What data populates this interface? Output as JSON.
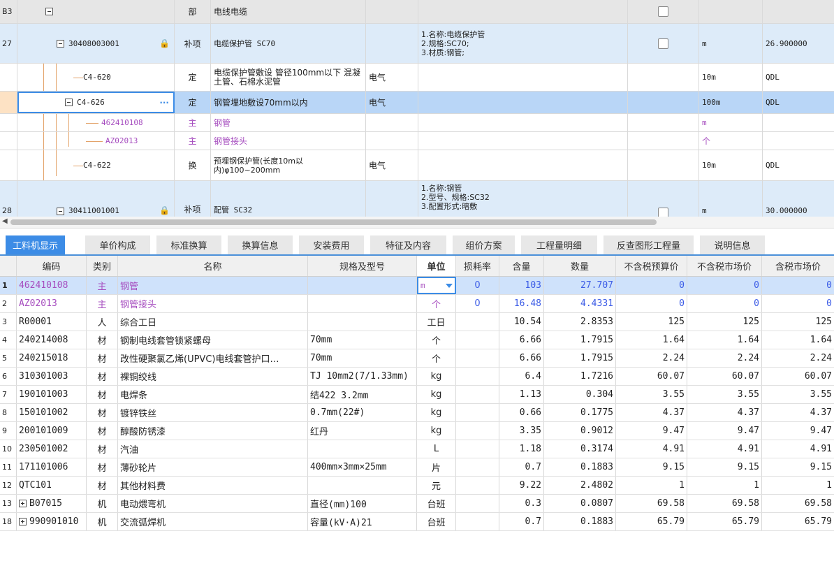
{
  "top_rows": [
    {
      "num": "B3",
      "code": "",
      "type": "部",
      "name": "电线电缆",
      "spec": "",
      "features": "",
      "unit": "",
      "qty": ""
    },
    {
      "num": "27",
      "code": "30408003001",
      "type": "补项",
      "name": "电缆保护管 SC70",
      "spec": "",
      "features": "1.名称:电缆保护管\n2.规格:SC70;\n3.材质:钢管;",
      "unit": "m",
      "qty": "26.900000"
    },
    {
      "num": "",
      "code": "C4-620",
      "type": "定",
      "name": "电缆保护管敷设 管径100mm以下 混凝土管、石棉水泥管",
      "spec": "电气",
      "features": "",
      "unit": "10m",
      "qty": "QDL"
    },
    {
      "num": "",
      "code": "C4-626",
      "type": "定",
      "name": "钢管埋地敷设70mm以内",
      "spec": "电气",
      "features": "",
      "unit": "100m",
      "qty": "QDL"
    },
    {
      "num": "",
      "code": "462410108",
      "type": "主",
      "name": "钢管",
      "spec": "",
      "features": "",
      "unit": "m",
      "qty": ""
    },
    {
      "num": "",
      "code": "AZ02013",
      "type": "主",
      "name": "钢管接头",
      "spec": "",
      "features": "",
      "unit": "个",
      "qty": ""
    },
    {
      "num": "",
      "code": "C4-622",
      "type": "换",
      "name": "预埋钢保护管(长度10m以内)φ100~200mm",
      "spec": "电气",
      "features": "",
      "unit": "10m",
      "qty": "QDL"
    },
    {
      "num": "28",
      "code": "30411001001",
      "type": "补项",
      "name": "配管 SC32",
      "spec": "",
      "features": "1.名称:钢管\n2.型号、规格:SC32\n3.配置形式:暗敷",
      "unit": "m",
      "qty": "30.000000"
    }
  ],
  "tabs": [
    "工料机显示",
    "单价构成",
    "标准换算",
    "换算信息",
    "安装费用",
    "特征及内容",
    "组价方案",
    "工程量明细",
    "反查图形工程量",
    "说明信息"
  ],
  "bottom_headers": [
    "",
    "编码",
    "类别",
    "名称",
    "规格及型号",
    "单位",
    "损耗率",
    "含量",
    "数量",
    "不含税预算价",
    "不含税市场价",
    "含税市场价"
  ],
  "bottom_rows": [
    {
      "n": "1",
      "code": "462410108",
      "cat": "主",
      "name": "钢管",
      "spec": "",
      "unit": "m",
      "loss": "0",
      "content": "103",
      "qty": "27.707",
      "p1": "0",
      "p2": "0",
      "p3": "0"
    },
    {
      "n": "2",
      "code": "AZ02013",
      "cat": "主",
      "name": "钢管接头",
      "spec": "",
      "unit": "个",
      "loss": "0",
      "content": "16.48",
      "qty": "4.4331",
      "p1": "0",
      "p2": "0",
      "p3": "0"
    },
    {
      "n": "3",
      "code": "R00001",
      "cat": "人",
      "name": "综合工日",
      "spec": "",
      "unit": "工日",
      "loss": "",
      "content": "10.54",
      "qty": "2.8353",
      "p1": "125",
      "p2": "125",
      "p3": "125"
    },
    {
      "n": "4",
      "code": "240214008",
      "cat": "材",
      "name": "钢制电线套管锁紧螺母",
      "spec": "70mm",
      "unit": "个",
      "loss": "",
      "content": "6.66",
      "qty": "1.7915",
      "p1": "1.64",
      "p2": "1.64",
      "p3": "1.64"
    },
    {
      "n": "5",
      "code": "240215018",
      "cat": "材",
      "name": "改性硬聚氯乙烯(UPVC)电线套管护口…",
      "spec": "70mm",
      "unit": "个",
      "loss": "",
      "content": "6.66",
      "qty": "1.7915",
      "p1": "2.24",
      "p2": "2.24",
      "p3": "2.24"
    },
    {
      "n": "6",
      "code": "310301003",
      "cat": "材",
      "name": "裸铜绞线",
      "spec": "TJ 10mm2(7/1.33mm)",
      "unit": "kg",
      "loss": "",
      "content": "6.4",
      "qty": "1.7216",
      "p1": "60.07",
      "p2": "60.07",
      "p3": "60.07"
    },
    {
      "n": "7",
      "code": "190101003",
      "cat": "材",
      "name": "电焊条",
      "spec": "结422 3.2mm",
      "unit": "kg",
      "loss": "",
      "content": "1.13",
      "qty": "0.304",
      "p1": "3.55",
      "p2": "3.55",
      "p3": "3.55"
    },
    {
      "n": "8",
      "code": "150101002",
      "cat": "材",
      "name": "镀锌铁丝",
      "spec": "0.7mm(22#)",
      "unit": "kg",
      "loss": "",
      "content": "0.66",
      "qty": "0.1775",
      "p1": "4.37",
      "p2": "4.37",
      "p3": "4.37"
    },
    {
      "n": "9",
      "code": "200101009",
      "cat": "材",
      "name": "醇酸防锈漆",
      "spec": "红丹",
      "unit": "kg",
      "loss": "",
      "content": "3.35",
      "qty": "0.9012",
      "p1": "9.47",
      "p2": "9.47",
      "p3": "9.47"
    },
    {
      "n": "10",
      "code": "230501002",
      "cat": "材",
      "name": "汽油",
      "spec": "",
      "unit": "L",
      "loss": "",
      "content": "1.18",
      "qty": "0.3174",
      "p1": "4.91",
      "p2": "4.91",
      "p3": "4.91"
    },
    {
      "n": "11",
      "code": "171101006",
      "cat": "材",
      "name": "薄砂轮片",
      "spec": "400mm×3mm×25mm",
      "unit": "片",
      "loss": "",
      "content": "0.7",
      "qty": "0.1883",
      "p1": "9.15",
      "p2": "9.15",
      "p3": "9.15"
    },
    {
      "n": "12",
      "code": "QTC101",
      "cat": "材",
      "name": "其他材料费",
      "spec": "",
      "unit": "元",
      "loss": "",
      "content": "9.22",
      "qty": "2.4802",
      "p1": "1",
      "p2": "1",
      "p3": "1"
    },
    {
      "n": "13",
      "code": "B07015",
      "cat": "机",
      "name": "电动煨弯机",
      "spec": "直径(mm)100",
      "unit": "台班",
      "loss": "",
      "content": "0.3",
      "qty": "0.0807",
      "p1": "69.58",
      "p2": "69.58",
      "p3": "69.58"
    },
    {
      "n": "18",
      "code": "990901010",
      "cat": "机",
      "name": "交流弧焊机",
      "spec": "容量(kV·A)21",
      "unit": "台班",
      "loss": "",
      "content": "0.7",
      "qty": "0.1883",
      "p1": "65.79",
      "p2": "65.79",
      "p3": "65.79"
    }
  ]
}
